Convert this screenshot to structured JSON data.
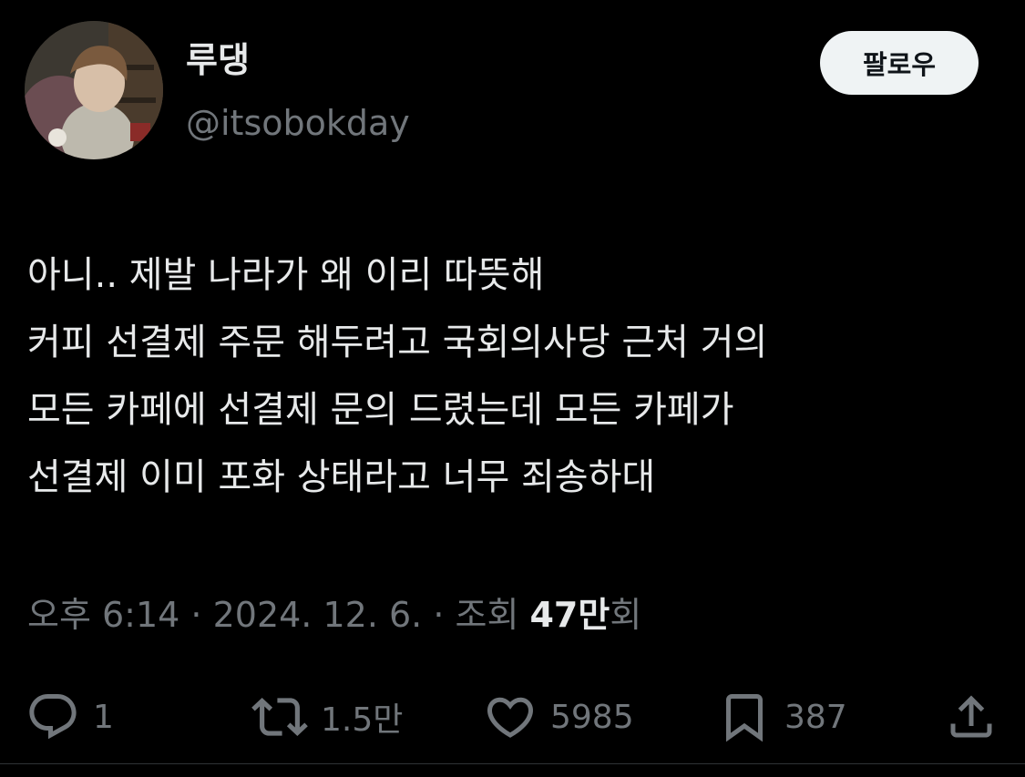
{
  "author": {
    "display_name": "루댕",
    "handle": "@itsobokday"
  },
  "follow_button": {
    "label": "팔로우"
  },
  "tweet": {
    "lines": [
      "아니.. 제발 나라가 왜 이리 따뜻해",
      "커피 선결제 주문 해두려고 국회의사당 근처 거의",
      "모든 카페에 선결제 문의 드렸는데 모든 카페가",
      "선결제 이미 포화 상태라고 너무 죄송하대"
    ],
    "time": "오후 6:14",
    "separator": " · ",
    "date": "2024. 12. 6.",
    "views_prefix": "조회 ",
    "views_count": "47만",
    "views_suffix": "회"
  },
  "actions": {
    "reply": {
      "icon": "reply-icon",
      "count": "1"
    },
    "retweet": {
      "icon": "retweet-icon",
      "count": "1.5만"
    },
    "like": {
      "icon": "heart-icon",
      "count": "5985"
    },
    "bookmark": {
      "icon": "bookmark-icon",
      "count": "387"
    },
    "share": {
      "icon": "share-icon"
    }
  },
  "colors": {
    "background": "#000000",
    "primary_text": "#e7e9ea",
    "secondary_text": "#71767b",
    "follow_button_bg": "#eff3f4",
    "follow_button_text": "#0f1419"
  }
}
